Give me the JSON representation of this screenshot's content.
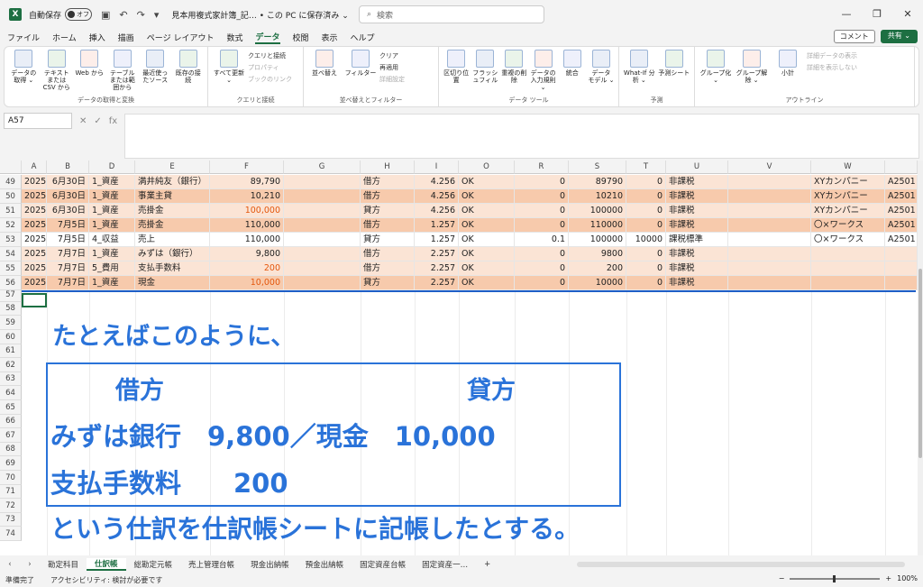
{
  "titlebar": {
    "autosave_label": "自動保存",
    "autosave_state": "オフ",
    "doc_title": "見本用複式家計簿_記… • この PC に保存済み ⌄",
    "search_placeholder": "検索"
  },
  "menu": [
    "ファイル",
    "ホーム",
    "挿入",
    "描画",
    "ページ レイアウト",
    "数式",
    "データ",
    "校閲",
    "表示",
    "ヘルプ"
  ],
  "menu_active": "データ",
  "menu_right": {
    "comment": "コメント",
    "share": "共有 ⌄"
  },
  "ribbon": {
    "groups": [
      {
        "label": "データの取得と変換",
        "buttons": [
          "データの取得 ⌄",
          "テキストまたは CSV から",
          "Web から",
          "テーブルまたは範囲から",
          "最近使ったソース",
          "既存の接続"
        ]
      },
      {
        "label": "クエリと接続",
        "buttons": [
          "すべて更新 ⌄"
        ],
        "small": [
          "クエリと接続",
          "プロパティ",
          "ブックのリンク"
        ]
      },
      {
        "label": "並べ替えとフィルター",
        "buttons": [
          "並べ替え",
          "フィルター"
        ],
        "small": [
          "クリア",
          "再適用",
          "詳細設定"
        ]
      },
      {
        "label": "データ ツール",
        "buttons": [
          "区切り位置",
          "フラッシュフィル",
          "重複の削除",
          "データの入力規則 ⌄",
          "統合",
          "データ モデル ⌄"
        ]
      },
      {
        "label": "予測",
        "buttons": [
          "What-If 分析 ⌄",
          "予測シート"
        ]
      },
      {
        "label": "アウトライン",
        "buttons": [
          "グループ化 ⌄",
          "グループ解除 ⌄",
          "小計"
        ],
        "small": [
          "詳細データの表示",
          "詳細を表示しない"
        ]
      }
    ]
  },
  "formula": {
    "namebox": "A57",
    "fx": "fx"
  },
  "columns": [
    "A",
    "B",
    "D",
    "E",
    "F",
    "G",
    "H",
    "I",
    "O",
    "R",
    "S",
    "T",
    "U",
    "V",
    "W"
  ],
  "rows": [
    {
      "num": "49",
      "cells": [
        "2025",
        "6月30日",
        "1_資産",
        "満井純友（銀行）",
        "89,790",
        "",
        "借方",
        "4.256",
        "OK",
        "0",
        "89790",
        "0",
        "非課税",
        "",
        "XYカンパニー",
        "A2501"
      ],
      "redF": false,
      "band": "a"
    },
    {
      "num": "50",
      "cells": [
        "2025",
        "6月30日",
        "1_資産",
        "事業主貸",
        "10,210",
        "",
        "借方",
        "4.256",
        "OK",
        "0",
        "10210",
        "0",
        "非課税",
        "",
        "XYカンパニー",
        "A2501"
      ],
      "redF": false,
      "band": "b"
    },
    {
      "num": "51",
      "cells": [
        "2025",
        "6月30日",
        "1_資産",
        "売掛金",
        "100,000",
        "",
        "貸方",
        "4.256",
        "OK",
        "0",
        "100000",
        "0",
        "非課税",
        "",
        "XYカンパニー",
        "A2501"
      ],
      "redF": true,
      "band": "a"
    },
    {
      "num": "52",
      "cells": [
        "2025",
        "7月5日",
        "1_資産",
        "売掛金",
        "110,000",
        "",
        "借方",
        "1.257",
        "OK",
        "0",
        "110000",
        "0",
        "非課税",
        "",
        "〇×ワークス",
        "A2501"
      ],
      "redF": false,
      "band": "b"
    },
    {
      "num": "53",
      "cells": [
        "2025",
        "7月5日",
        "4_収益",
        "売上",
        "110,000",
        "",
        "貸方",
        "1.257",
        "OK",
        "0.1",
        "100000",
        "10000",
        "課税標準",
        "",
        "〇×ワークス",
        "A2501"
      ],
      "redF": false,
      "band": "n"
    },
    {
      "num": "54",
      "cells": [
        "2025",
        "7月7日",
        "1_資産",
        "みずは（銀行）",
        "9,800",
        "",
        "借方",
        "2.257",
        "OK",
        "0",
        "9800",
        "0",
        "非課税",
        "",
        "",
        ""
      ],
      "redF": false,
      "band": "a"
    },
    {
      "num": "55",
      "cells": [
        "2025",
        "7月7日",
        "5_費用",
        "支払手数料",
        "200",
        "",
        "借方",
        "2.257",
        "OK",
        "0",
        "200",
        "0",
        "非課税",
        "",
        "",
        ""
      ],
      "redF": true,
      "band": "a"
    },
    {
      "num": "56",
      "cells": [
        "2025",
        "7月7日",
        "1_資産",
        "現金",
        "10,000",
        "",
        "貸方",
        "2.257",
        "OK",
        "0",
        "10000",
        "0",
        "非課税",
        "",
        "",
        ""
      ],
      "redF": true,
      "band": "b"
    }
  ],
  "empty_rows": [
    "57",
    "58",
    "59",
    "60",
    "61",
    "62",
    "63",
    "64",
    "65",
    "66",
    "67",
    "68",
    "69",
    "70",
    "71",
    "72",
    "73",
    "74"
  ],
  "annotation": {
    "intro": "たとえばこのように、",
    "debit_head": "借方",
    "credit_head": "貸方",
    "line1": "みずは銀行　9,800／現金　10,000",
    "line2": "支払手数料　　200",
    "outro": "という仕訳を仕訳帳シートに記帳したとする。"
  },
  "tabs": [
    "勘定科目",
    "仕訳帳",
    "総勘定元帳",
    "売上管理台帳",
    "現金出納帳",
    "預金出納帳",
    "固定資産台帳",
    "固定資産一…",
    "+"
  ],
  "tab_active": "仕訳帳",
  "status": {
    "ready": "準備完了",
    "accessibility": "アクセシビリティ: 検討が必要です",
    "zoom": "100%"
  }
}
